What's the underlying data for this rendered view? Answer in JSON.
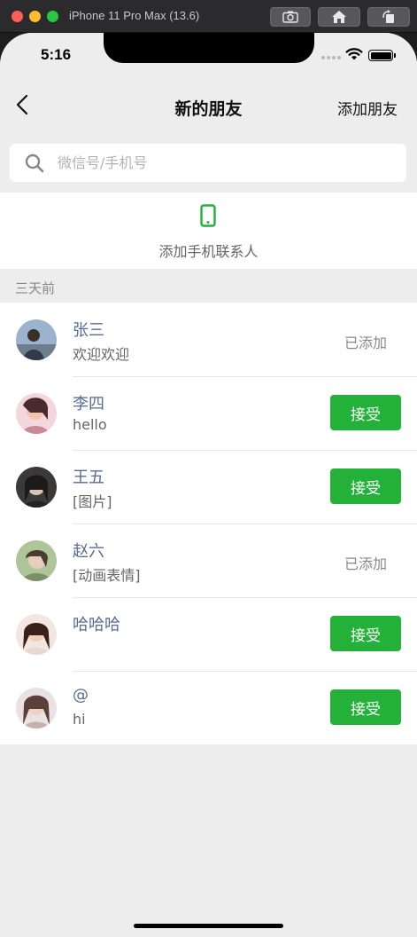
{
  "simulator": {
    "title": "iPhone 11 Pro Max (13.6)",
    "buttons": [
      "screenshot-icon",
      "home-icon",
      "rotate-icon"
    ]
  },
  "status_bar": {
    "time": "5:16"
  },
  "nav": {
    "title": "新的朋友",
    "action": "添加朋友"
  },
  "search": {
    "placeholder": "微信号/手机号",
    "value": ""
  },
  "add_contacts": {
    "label": "添加手机联系人",
    "icon": "mobile-phone-icon",
    "color": "#24b13a"
  },
  "section": {
    "label": "三天前"
  },
  "friends": [
    {
      "name": "张三",
      "message": "欢迎欢迎",
      "status": "已添加"
    },
    {
      "name": "李四",
      "message": "hello",
      "action": "接受"
    },
    {
      "name": "王五",
      "message": "[图片]",
      "action": "接受"
    },
    {
      "name": "赵六",
      "message": "[动画表情]",
      "status": "已添加"
    },
    {
      "name": "哈哈哈",
      "message": "",
      "action": "接受"
    },
    {
      "name": "@",
      "message": "hi",
      "action": "接受"
    }
  ],
  "colors": {
    "accent": "#24b13a",
    "name": "#576b95",
    "background": "#ededed"
  }
}
